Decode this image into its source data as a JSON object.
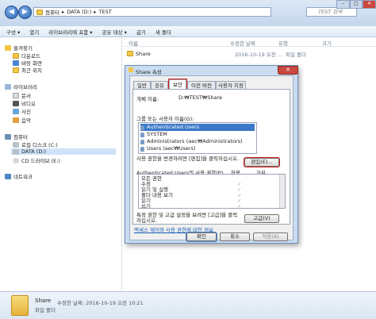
{
  "window": {
    "nav_back": "◀",
    "nav_forward": "▶",
    "address": [
      "컴퓨터",
      "DATA (D:)",
      "TEST"
    ],
    "search_placeholder": "TEST 검색",
    "controls": [
      "–",
      "□",
      "✕"
    ]
  },
  "toolbar": [
    "구성 ▾",
    "열기",
    "라이브러리에 포함 ▾",
    "공유 대상 ▾",
    "굽기",
    "새 폴더"
  ],
  "columns": [
    "이름",
    "수정한 날짜",
    "유형",
    "크기"
  ],
  "nav": {
    "favorites": "즐겨찾기",
    "fav_items": [
      "다운로드",
      "바탕 화면",
      "최근 위치"
    ],
    "libraries": "라이브러리",
    "lib_items": [
      "문서",
      "비디오",
      "사진",
      "음악"
    ],
    "computer": "컴퓨터",
    "comp_items": [
      "로컬 디스크 (C:)",
      "DATA (D:)",
      "CD 드라이브 (E:)"
    ],
    "network": "네트워크"
  },
  "files": [
    {
      "name": "Share",
      "date": "2016-10-19 오전 ...",
      "type": "파일 폴더"
    }
  ],
  "status": {
    "name": "Share",
    "modified_label": "수정한 날짜: 2016-10-19 오전 10:21",
    "type": "파일 폴더"
  },
  "dialog": {
    "title": "Share 속성",
    "close": "✕",
    "tabs": [
      "일반",
      "공유",
      "보안",
      "이전 버전",
      "사용자 지정"
    ],
    "active_tab": "보안",
    "object_label": "개체 이름:",
    "object_value": "D:₩TEST₩Share",
    "groups_label": "그룹 또는 사용자 이름(G):",
    "users": [
      "Authenticated Users",
      "SYSTEM",
      "Administrators (aec₩Administrators)",
      "Users (aec₩Users)"
    ],
    "change_text": "사용 권한을 변경하려면 [편집]을 클릭하십시오.",
    "edit_button": "편집(E)...",
    "perm_header": "Authenticated Users의 사용 권한(P)",
    "allow": "허용",
    "deny": "거부",
    "permissions": [
      {
        "name": "모든 권한",
        "allow": ""
      },
      {
        "name": "수정",
        "allow": "✓"
      },
      {
        "name": "읽기 및 실행",
        "allow": "✓"
      },
      {
        "name": "폴더 내용 보기",
        "allow": "✓"
      },
      {
        "name": "읽기",
        "allow": "✓"
      },
      {
        "name": "쓰기",
        "allow": "✓"
      }
    ],
    "advanced_text": "특정 권한 및 고급 설정을 보려면 [고급]을 클릭하십시오.",
    "advanced_button": "고급(V)",
    "link_text": "액세스 제어와 사용 권한에 대한 정보",
    "ok": "확인",
    "cancel": "취소",
    "apply": "적용(A)"
  }
}
